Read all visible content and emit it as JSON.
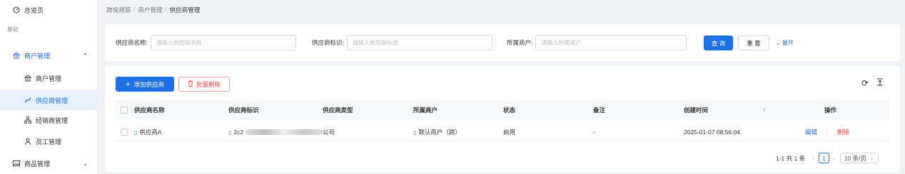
{
  "sidebar": {
    "overview": "总览页",
    "group": "基础",
    "merchant_mgmt": "商户管理",
    "items": [
      "商户管理",
      "供应商管理",
      "经销商管理",
      "员工管理"
    ],
    "goods_mgmt": "商品管理"
  },
  "breadcrumb": [
    "跨境溯源",
    "商户管理",
    "供应商管理"
  ],
  "search": {
    "fields": [
      {
        "label": "供应商名称:",
        "placeholder": "请输入供应商名称"
      },
      {
        "label": "供应商标识:",
        "placeholder": "请输入供应商标识"
      },
      {
        "label": "所属商户:",
        "placeholder": "请输入所属商户"
      }
    ],
    "query_btn": "查 询",
    "reset_btn": "重 置",
    "expand": "展开"
  },
  "toolbar": {
    "add_btn": "添加供应商",
    "batch_delete_btn": "批量删除"
  },
  "table": {
    "columns": [
      "供应商名称",
      "供应商标识",
      "供应商类型",
      "所属商户",
      "状态",
      "备注",
      "创建时间",
      "操作"
    ],
    "rows": [
      {
        "name": "供应商A",
        "id_prefix": "2c2",
        "type": "公司",
        "merchant": "默认商户（跨）",
        "status": "启用",
        "remark": "-",
        "created": "2025-01-07 08:56:04",
        "edit": "编辑",
        "delete": "删除"
      }
    ]
  },
  "pagination": {
    "summary": "1-1 共 1 条",
    "current_page": "1",
    "page_size": "10 条/页"
  },
  "colors": {
    "primary": "#1f6fe5",
    "danger": "#f04848"
  }
}
